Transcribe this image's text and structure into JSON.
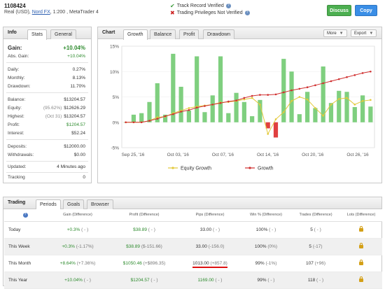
{
  "header": {
    "account_id": "1108424",
    "account_type": "Real (USD),",
    "broker": "Nord FX",
    "details": ", 1:200 , MetaTrader 4",
    "verification": [
      {
        "label": "Track Record Verified",
        "status": "ok"
      },
      {
        "label": "Trading Privileges Not Verified",
        "status": "no"
      }
    ],
    "discuss_label": "Discuss",
    "copy_label": "Copy"
  },
  "info": {
    "tabs": [
      "Stats",
      "General"
    ],
    "title": "Info",
    "gain": {
      "label": "Gain:",
      "value": "+10.04%"
    },
    "abs_gain": {
      "label": "Abs. Gain:",
      "value": "+10.04%"
    },
    "daily": {
      "label": "Daily:",
      "value": "0.27%"
    },
    "monthly": {
      "label": "Monthly:",
      "value": "8.13%"
    },
    "drawdown": {
      "label": "Drawdown:",
      "value": "11.70%"
    },
    "balance": {
      "label": "Balance:",
      "value": "$13204.57"
    },
    "equity": {
      "label": "Equity:",
      "note": "(95.62%)",
      "value": "$12626.29"
    },
    "highest": {
      "label": "Highest:",
      "note": "(Oct 31)",
      "value": "$13204.57"
    },
    "profit": {
      "label": "Profit:",
      "value": "$1204.57"
    },
    "interest": {
      "label": "Interest:",
      "value": "$52.24"
    },
    "deposits": {
      "label": "Deposits:",
      "value": "$12000.00"
    },
    "withdrawals": {
      "label": "Withdrawals:",
      "value": "$0.00"
    },
    "updated": {
      "label": "Updated:",
      "value": "4 Minutes ago"
    },
    "tracking": {
      "label": "Tracking",
      "value": "0"
    }
  },
  "chart": {
    "title": "Chart",
    "tabs": [
      "Growth",
      "Balance",
      "Profit",
      "Drawdown"
    ],
    "more_label": "More",
    "export_label": "Export"
  },
  "chart_data": {
    "type": "bar",
    "y_ticks": [
      "15%",
      "10%",
      "5%",
      "0%",
      "-5%"
    ],
    "ylim": [
      -5,
      15
    ],
    "x_ticks": [
      "Sep 25, '16",
      "Oct 03, '16",
      "Oct 07, '16",
      "Oct 14, '16",
      "Oct 20, '16",
      "Oct 26, '16"
    ],
    "bars": [
      0,
      1.5,
      1.8,
      4,
      7.7,
      1.5,
      13.5,
      7,
      2.3,
      13,
      2,
      5.3,
      13,
      1.8,
      5.8,
      4,
      1.2,
      4.4,
      -1.2,
      -3,
      12.5,
      10,
      1.6,
      6,
      2.8,
      11,
      3.8,
      6.2,
      6,
      3,
      5.3,
      3.1
    ],
    "series": [
      {
        "name": "Equity Growth",
        "color": "#e3c93a",
        "values": [
          0,
          0,
          0,
          0.3,
          1.0,
          1.1,
          1.8,
          2.3,
          2.8,
          3.1,
          3.3,
          3.5,
          3.9,
          4.0,
          4.2,
          4.5,
          4.8,
          3.5,
          -2.3,
          0.6,
          2.0,
          4.2,
          5.0,
          4.5,
          2.8,
          1.3,
          3.5,
          4.6,
          4.8,
          3.5,
          4.2,
          4.4
        ]
      },
      {
        "name": "Growth",
        "color": "#d03030",
        "values": [
          0,
          0,
          0,
          0.3,
          0.7,
          1.2,
          1.6,
          2.1,
          2.4,
          2.9,
          3.2,
          3.5,
          3.8,
          4.1,
          4.3,
          4.8,
          5.2,
          5.4,
          5.4,
          5.5,
          5.9,
          6.3,
          6.6,
          6.9,
          7.3,
          7.7,
          8.1,
          8.5,
          8.9,
          9.3,
          9.7,
          10.0
        ]
      }
    ],
    "bar_colors": {
      "positive": "#7fcf7f",
      "negative": "#e04040"
    },
    "legend": [
      "Equity Growth",
      "Growth"
    ],
    "legend_position": "bottom"
  },
  "trading": {
    "title": "Trading",
    "tabs": [
      "Periods",
      "Goals",
      "Browser"
    ],
    "columns": [
      "Gain (Difference)",
      "Profit (Difference)",
      "Pips (Difference)",
      "Win % (Difference)",
      "Trades (Difference)",
      "Lots (Difference)"
    ],
    "rows": [
      {
        "period": "Today",
        "gain": "+0.3%",
        "gain_diff": "( - )",
        "profit": "$38.89",
        "profit_diff": "( - )",
        "pips": "33.00",
        "pips_diff": "( - )",
        "win": "100%",
        "win_diff": "( - )",
        "trades": "5",
        "trades_diff": "( - )"
      },
      {
        "period": "This Week",
        "gain": "+0.3%",
        "gain_diff": "(-1.17%)",
        "profit": "$38.89",
        "profit_diff": "($-151.66)",
        "pips": "33.00",
        "pips_diff": "(-156.0)",
        "win": "100%",
        "win_diff": "(0%)",
        "trades": "5",
        "trades_diff": "(-17)"
      },
      {
        "period": "This Month",
        "gain": "+8.64%",
        "gain_diff": "(+7.36%)",
        "profit": "$1050.46",
        "profit_diff": "(+$896.35)",
        "pips": "1013.00",
        "pips_diff": "(+857.8)",
        "win": "99%",
        "win_diff": "(-1%)",
        "trades": "107",
        "trades_diff": "(+96)"
      },
      {
        "period": "This Year",
        "gain": "+10.04%",
        "gain_diff": "( - )",
        "profit": "$1204.57",
        "profit_diff": "( - )",
        "pips": "1169.00",
        "pips_diff": "( - )",
        "win": "99%",
        "win_diff": "( - )",
        "trades": "118",
        "trades_diff": "( - )"
      }
    ]
  }
}
